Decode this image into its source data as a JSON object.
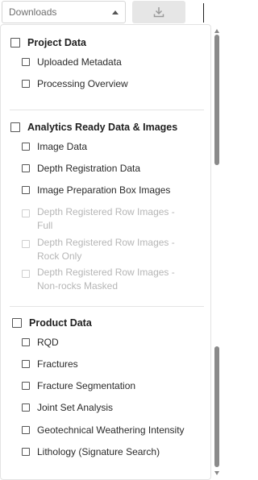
{
  "toolbar": {
    "dropdown_value": "Downloads",
    "download_icon": "download-icon"
  },
  "sections": [
    {
      "title": "Project Data",
      "items": [
        {
          "label": "Uploaded Metadata",
          "disabled": false
        },
        {
          "label": "Processing Overview",
          "disabled": false
        }
      ]
    },
    {
      "title": "Analytics Ready Data & Images",
      "items": [
        {
          "label": "Image Data",
          "disabled": false
        },
        {
          "label": "Depth Registration Data",
          "disabled": false
        },
        {
          "label": "Image Preparation Box Images",
          "disabled": false
        },
        {
          "label": "Depth Registered Row Images - Full",
          "disabled": true
        },
        {
          "label": "Depth Registered Row Images - Rock Only",
          "disabled": true
        },
        {
          "label": "Depth Registered Row Images - Non-rocks Masked",
          "disabled": true
        }
      ]
    },
    {
      "title": "Product Data",
      "items": [
        {
          "label": "RQD",
          "disabled": false
        },
        {
          "label": "Fractures",
          "disabled": false
        },
        {
          "label": "Fracture Segmentation",
          "disabled": false
        },
        {
          "label": "Joint Set Analysis",
          "disabled": false
        },
        {
          "label": "Geotechnical Weathering Intensity",
          "disabled": false
        },
        {
          "label": "Lithology (Signature Search)",
          "disabled": false
        }
      ]
    }
  ]
}
